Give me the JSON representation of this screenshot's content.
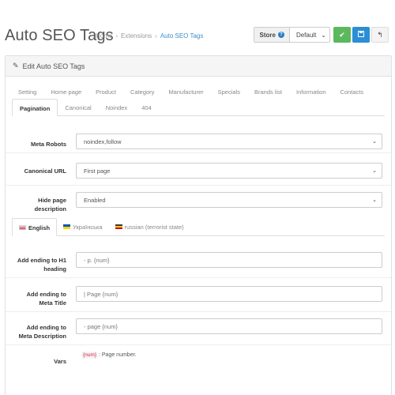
{
  "header": {
    "title": "Auto SEO Tags",
    "breadcrumb": [
      "Home",
      "Extensions",
      "Auto SEO Tags"
    ],
    "store_label": "Store",
    "store_value": "Default"
  },
  "panel": {
    "heading": "Edit Auto SEO Tags",
    "tabs_top": [
      "Setting",
      "Home page",
      "Product",
      "Category",
      "Manufacturer",
      "Specials",
      "Brands list",
      "Information",
      "Contacts"
    ],
    "tabs_second": [
      "Pagination",
      "Canonical",
      "Noindex",
      "404"
    ],
    "active_tab": "Pagination"
  },
  "form": {
    "meta_robots": {
      "label": "Meta Robots",
      "value": "noindex,follow"
    },
    "canonical_url": {
      "label": "Canonical URL",
      "value": "First page"
    },
    "hide_page_description": {
      "label_line1": "Hide page",
      "label_line2": "description",
      "value": "Enabled"
    }
  },
  "lang_tabs": [
    "English",
    "Українська",
    "russian (terrorist state)"
  ],
  "lang_form": {
    "h1_ending": {
      "label_line1": "Add ending to H1",
      "label_line2": "heading",
      "value": "- p. {num}"
    },
    "meta_title_ending": {
      "label_line1": "Add ending to",
      "label_line2": "Meta Title",
      "value": "| Page {num}"
    },
    "meta_desc_ending": {
      "label_line1": "Add ending to",
      "label_line2": "Meta Description",
      "value": "- page {num}"
    },
    "vars": {
      "label": "Vars",
      "tag": "{num}",
      "text": ": Page number."
    }
  },
  "colors": {
    "save": "#5cb85c",
    "apply": "#2b8ed6",
    "link": "#3d8ec9"
  }
}
